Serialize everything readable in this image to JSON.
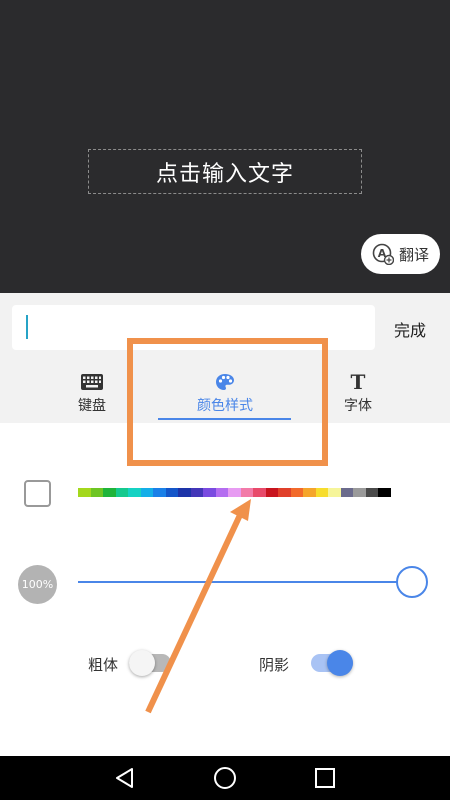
{
  "preview": {
    "text_placeholder": "点击输入文字",
    "translate_label": "翻译"
  },
  "input": {
    "value": "",
    "done_label": "完成"
  },
  "tabs": [
    {
      "label": "键盘",
      "icon": "keyboard-icon"
    },
    {
      "label": "颜色样式",
      "icon": "palette-icon",
      "selected": true
    },
    {
      "label": "字体",
      "icon": "font-icon"
    }
  ],
  "colors": {
    "accent": "#4a86e8",
    "preview_bg": "#2b2b2d",
    "highlight": "#f0914b",
    "palette": [
      "#a4d81c",
      "#6ec523",
      "#1fb43a",
      "#15c98e",
      "#15d2c3",
      "#14aee8",
      "#1a80e8",
      "#1456c9",
      "#1d34a8",
      "#4336b8",
      "#7a4be0",
      "#b46df0",
      "#e79bf2",
      "#f27aa8",
      "#e84a6a",
      "#c8141e",
      "#e0402a",
      "#f26a2b",
      "#f5a52b",
      "#f7dd2d",
      "#f6f59a",
      "#6b6b8c",
      "#9a9a9a",
      "#4a4a4a",
      "#000000"
    ]
  },
  "style": {
    "opacity_label": "100%",
    "opacity_value": 1.0,
    "bold_label": "粗体",
    "bold_on": false,
    "shadow_label": "阴影",
    "shadow_on": true
  },
  "nav": {
    "back_icon": "back-triangle-icon",
    "home_icon": "home-circle-icon",
    "recent_icon": "recent-square-icon"
  }
}
